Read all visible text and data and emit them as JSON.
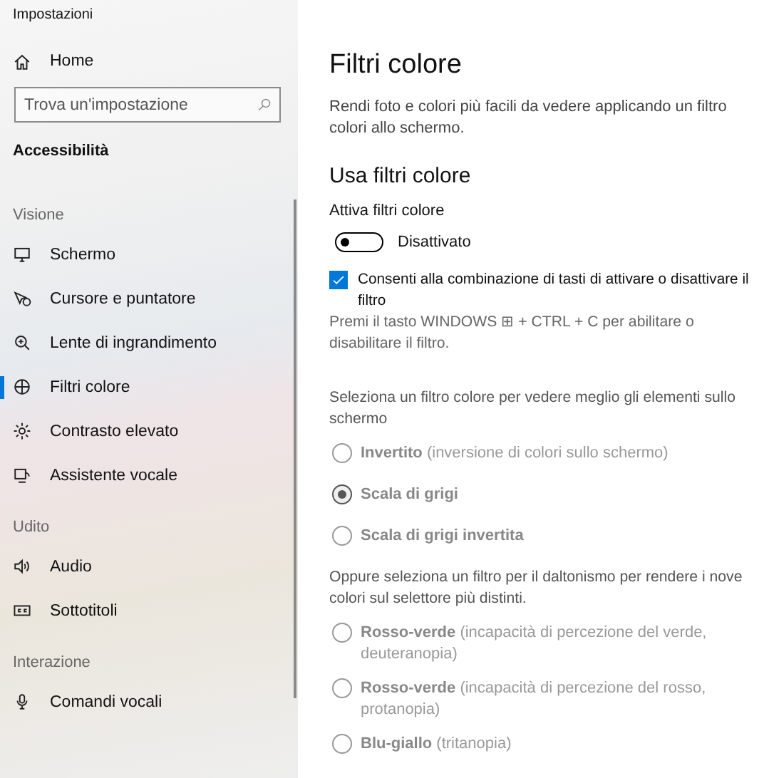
{
  "window": {
    "title": "Impostazioni"
  },
  "sidebar": {
    "home": "Home",
    "search": {
      "placeholder": "Trova un'impostazione"
    },
    "category": "Accessibilità",
    "groups": [
      {
        "heading": "Visione",
        "items": [
          {
            "label": "Schermo",
            "selected": false
          },
          {
            "label": "Cursore e puntatore",
            "selected": false
          },
          {
            "label": "Lente di ingrandimento",
            "selected": false
          },
          {
            "label": "Filtri colore",
            "selected": true
          },
          {
            "label": "Contrasto elevato",
            "selected": false
          },
          {
            "label": "Assistente vocale",
            "selected": false
          }
        ]
      },
      {
        "heading": "Udito",
        "items": [
          {
            "label": "Audio",
            "selected": false
          },
          {
            "label": "Sottotitoli",
            "selected": false
          }
        ]
      },
      {
        "heading": "Interazione",
        "items": [
          {
            "label": "Comandi vocali",
            "selected": false
          }
        ]
      }
    ]
  },
  "main": {
    "title": "Filtri colore",
    "description": "Rendi foto e colori più facili da vedere applicando un filtro colori allo schermo.",
    "section_heading": "Usa filtri colore",
    "toggle": {
      "label": "Attiva filtri colore",
      "on": false,
      "state_text": "Disattivato"
    },
    "shortcut": {
      "label": "Consenti alla combinazione di tasti di attivare o disattivare il filtro",
      "checked": true,
      "hint": "Premi il tasto WINDOWS ⊞ + CTRL + C per abilitare o disabilitare il filtro."
    },
    "filters_prompt": "Seleziona un filtro colore per vedere meglio gli elementi sullo schermo",
    "filters": [
      {
        "label": "**Invertito** (inversione di colori sullo schermo)",
        "selected": false,
        "disabled": true
      },
      {
        "label": "**Scala di grigi**",
        "selected": true,
        "disabled": true
      },
      {
        "label": "**Scala di grigi invertita**",
        "selected": false,
        "disabled": true
      }
    ],
    "colorblind_prompt": "Oppure seleziona un filtro per il daltonismo per rendere i nove colori sul selettore più distinti.",
    "colorblind_filters": [
      {
        "label": "**Rosso-verde** (incapacità di percezione del verde, deuteranopia)",
        "selected": false,
        "disabled": true
      },
      {
        "label": "**Rosso-verde** (incapacità di percezione del rosso, protanopia)",
        "selected": false,
        "disabled": true
      },
      {
        "label": "**Blu-giallo** (tritanopia)",
        "selected": false,
        "disabled": true
      }
    ]
  }
}
